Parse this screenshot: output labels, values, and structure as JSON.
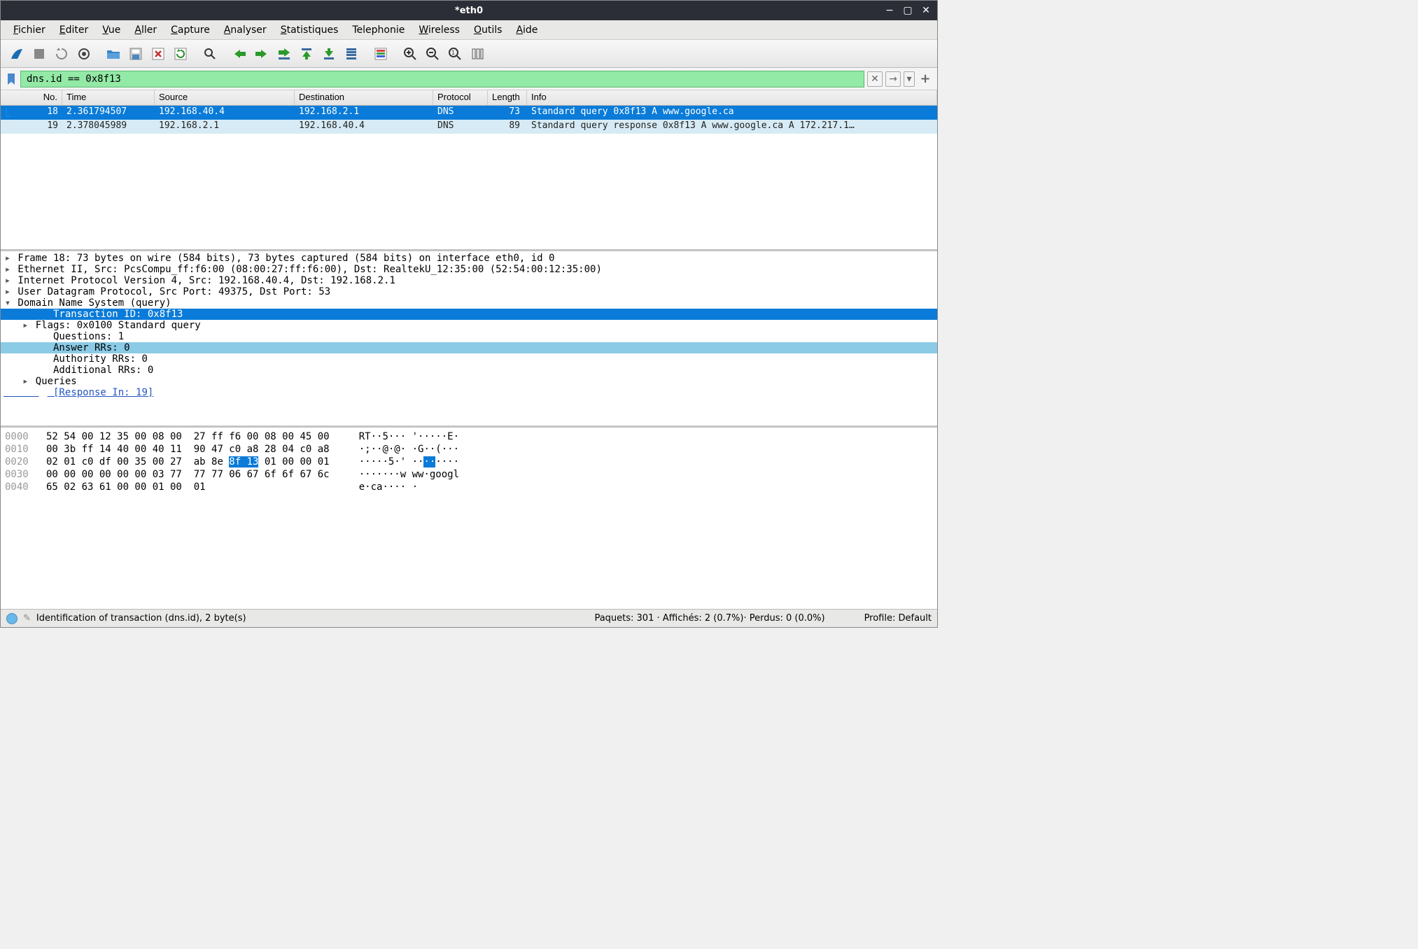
{
  "window": {
    "title": "*eth0"
  },
  "menubar": [
    {
      "label": "Fichier",
      "u": 0
    },
    {
      "label": "Editer",
      "u": 0
    },
    {
      "label": "Vue",
      "u": 0
    },
    {
      "label": "Aller",
      "u": 0
    },
    {
      "label": "Capture",
      "u": 0
    },
    {
      "label": "Analyser",
      "u": 0
    },
    {
      "label": "Statistiques",
      "u": 0
    },
    {
      "label": "Telephonie",
      "u": -1
    },
    {
      "label": "Wireless",
      "u": 0
    },
    {
      "label": "Outils",
      "u": 0
    },
    {
      "label": "Aide",
      "u": 0
    }
  ],
  "filter": {
    "value": "dns.id == 0x8f13"
  },
  "packet_list": {
    "columns": [
      "No.",
      "Time",
      "Source",
      "Destination",
      "Protocol",
      "Length",
      "Info"
    ],
    "rows": [
      {
        "no": "18",
        "time": "2.361794507",
        "src": "192.168.40.4",
        "dst": "192.168.2.1",
        "proto": "DNS",
        "len": "73",
        "info": "Standard query 0x8f13 A www.google.ca",
        "selected": true,
        "marker": true
      },
      {
        "no": "19",
        "time": "2.378045989",
        "src": "192.168.2.1",
        "dst": "192.168.40.4",
        "proto": "DNS",
        "len": "89",
        "info": "Standard query response 0x8f13 A www.google.ca A 172.217.1…",
        "related": true
      }
    ]
  },
  "details": [
    {
      "indent": 0,
      "arrow": "▸",
      "text": "Frame 18: 73 bytes on wire (584 bits), 73 bytes captured (584 bits) on interface eth0, id 0"
    },
    {
      "indent": 0,
      "arrow": "▸",
      "text": "Ethernet II, Src: PcsCompu_ff:f6:00 (08:00:27:ff:f6:00), Dst: RealtekU_12:35:00 (52:54:00:12:35:00)"
    },
    {
      "indent": 0,
      "arrow": "▸",
      "text": "Internet Protocol Version 4, Src: 192.168.40.4, Dst: 192.168.2.1"
    },
    {
      "indent": 0,
      "arrow": "▸",
      "text": "User Datagram Protocol, Src Port: 49375, Dst Port: 53"
    },
    {
      "indent": 0,
      "arrow": "▾",
      "text": "Domain Name System (query)"
    },
    {
      "indent": 2,
      "arrow": " ",
      "text": "Transaction ID: 0x8f13",
      "sel": true
    },
    {
      "indent": 1,
      "arrow": "▸",
      "text": "Flags: 0x0100 Standard query"
    },
    {
      "indent": 2,
      "arrow": " ",
      "text": "Questions: 1"
    },
    {
      "indent": 2,
      "arrow": " ",
      "text": "Answer RRs: 0",
      "hl": true
    },
    {
      "indent": 2,
      "arrow": " ",
      "text": "Authority RRs: 0"
    },
    {
      "indent": 2,
      "arrow": " ",
      "text": "Additional RRs: 0"
    },
    {
      "indent": 1,
      "arrow": "▸",
      "text": "Queries"
    },
    {
      "indent": 2,
      "arrow": " ",
      "text": "[Response In: 19]",
      "link": true
    }
  ],
  "hex": {
    "lines": [
      {
        "offset": "0000",
        "bytes": "52 54 00 12 35 00 08 00  27 ff f6 00 08 00 45 00",
        "ascii": "RT··5··· '·····E·"
      },
      {
        "offset": "0010",
        "bytes": "00 3b ff 14 40 00 40 11  90 47 c0 a8 28 04 c0 a8",
        "ascii": "·;··@·@· ·G··(···"
      },
      {
        "offset": "0020",
        "bytes_pre": "02 01 c0 df 00 35 00 27  ab 8e ",
        "bytes_hl": "8f 13",
        "bytes_post": " 01 00 00 01",
        "ascii_pre": "·····5·' ··",
        "ascii_hl": "··",
        "ascii_post": "····"
      },
      {
        "offset": "0030",
        "bytes": "00 00 00 00 00 00 03 77  77 77 06 67 6f 6f 67 6c",
        "ascii": "·······w ww·googl"
      },
      {
        "offset": "0040",
        "bytes": "65 02 63 61 00 00 01 00  01",
        "ascii": "e·ca···· ·"
      }
    ]
  },
  "statusbar": {
    "left": "Identification of transaction (dns.id), 2 byte(s)",
    "center": "Paquets: 301 · Affichés: 2 (0.7%)· Perdus: 0 (0.0%)",
    "right": "Profile: Default"
  }
}
